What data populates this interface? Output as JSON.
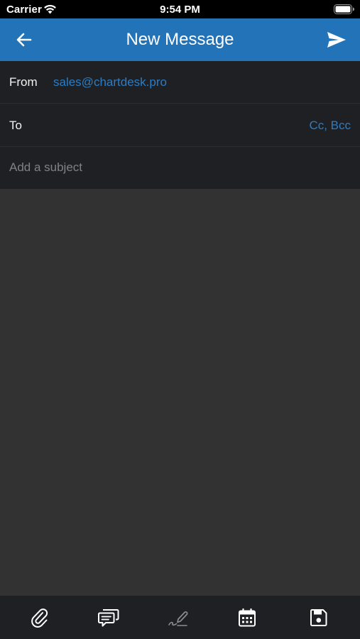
{
  "status_bar": {
    "carrier": "Carrier",
    "time": "9:54 PM",
    "wifi_icon": "wifi-icon",
    "battery_icon": "battery-icon"
  },
  "header": {
    "title": "New Message",
    "back_icon": "arrow-left-icon",
    "send_icon": "send-icon",
    "background_color": "#2373b8"
  },
  "form": {
    "from_label": "From",
    "from_value": "sales@chartdesk.pro",
    "to_label": "To",
    "to_value": "",
    "cc_bcc_label": "Cc, Bcc",
    "subject_value": "",
    "subject_placeholder": "Add a subject",
    "accent_color": "#2a7dc6"
  },
  "body": {
    "value": ""
  },
  "toolbar": {
    "items": [
      {
        "icon": "paperclip-icon"
      },
      {
        "icon": "chat-bubbles-icon"
      },
      {
        "icon": "signature-pen-icon"
      },
      {
        "icon": "calendar-icon"
      },
      {
        "icon": "save-icon"
      }
    ]
  }
}
